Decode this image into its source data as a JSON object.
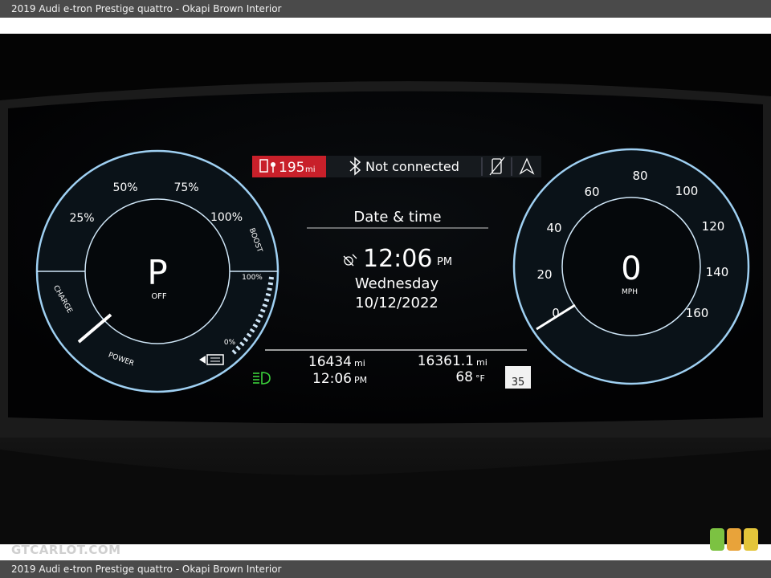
{
  "caption": "2019 Audi e-tron Prestige quattro - Okapi Brown Interior",
  "watermark": "GTCARLOT.COM",
  "status_bar": {
    "range_value": "195",
    "range_unit": "mi",
    "bluetooth_status": "Not connected"
  },
  "left_gauge": {
    "labels": [
      "25%",
      "50%",
      "75%",
      "100%",
      "BOOST",
      "CHARGE",
      "POWER",
      "100%",
      "0%"
    ],
    "gear": "P",
    "state": "OFF"
  },
  "center": {
    "title": "Date & time",
    "time": "12:06",
    "ampm": "PM",
    "day": "Wednesday",
    "date": "10/12/2022"
  },
  "trip": {
    "odometer": "16434",
    "odometer_unit": "mi",
    "trip_distance": "16361.1",
    "trip_unit": "mi",
    "clock": "12:06",
    "clock_ampm": "PM",
    "temperature": "68",
    "temperature_unit": "°F",
    "speed_limit": "35"
  },
  "speedometer": {
    "ticks": [
      "0",
      "20",
      "40",
      "60",
      "80",
      "100",
      "120",
      "140",
      "160"
    ],
    "speed": "0",
    "unit": "MPH"
  },
  "colors": {
    "range_badge": "#c8202a",
    "gauge_blue": "#8ec6ee",
    "headlight_green": "#3bd23b"
  },
  "icons": [
    "fuel-range-icon",
    "bluetooth-icon",
    "phone-off-icon",
    "navigation-arrow-icon",
    "satellite-clock-icon",
    "battery-icon",
    "headlight-icon",
    "speed-limit-sign-icon"
  ]
}
